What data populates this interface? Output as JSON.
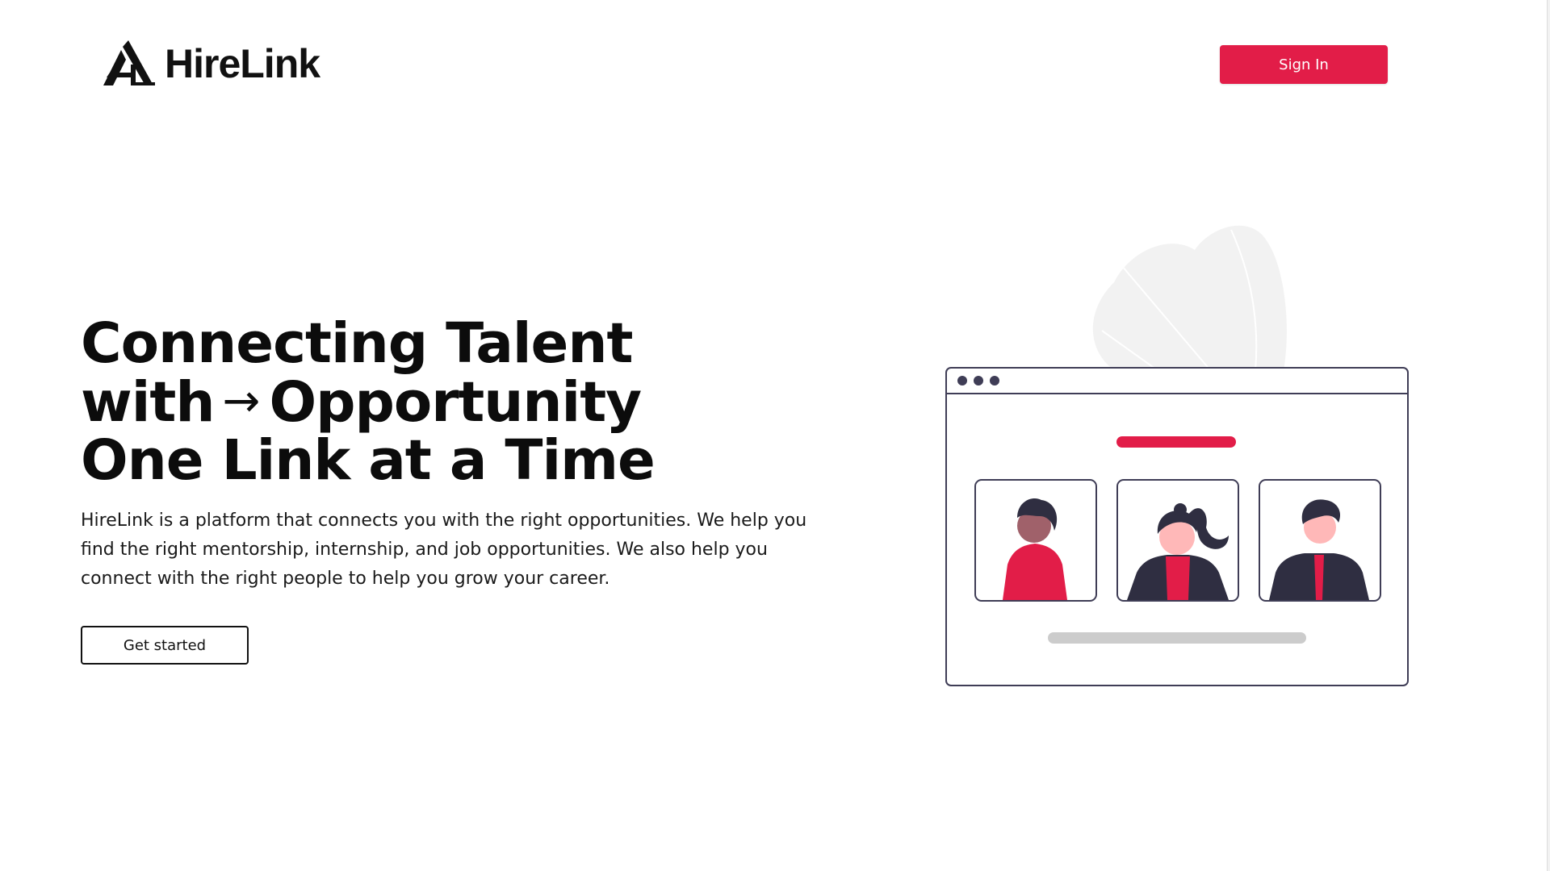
{
  "header": {
    "brand_name": "HireLink",
    "sign_in_label": "Sign In"
  },
  "hero": {
    "title_line1": "Connecting Talent",
    "title_line2_pre": "with",
    "title_arrow": "→",
    "title_line2_post": "Opportunity",
    "title_line3": "One Link at a Time",
    "description": "HireLink is a platform that connects you with the right opportunities. We help you find the right mentorship, internship, and job opportunities. We also help you connect with the right people to help you grow your career.",
    "cta_label": "Get started"
  },
  "icons": {
    "logo": "hirelink-logo-icon",
    "hero_arrow": "right-arrow-icon"
  },
  "colors": {
    "accent": "#e21d48",
    "text": "#111111",
    "frame_border": "#3f3d56",
    "dark_clothing": "#2f2e41",
    "leaf": "#f2f2f2",
    "bar_gray": "#cccccc"
  }
}
